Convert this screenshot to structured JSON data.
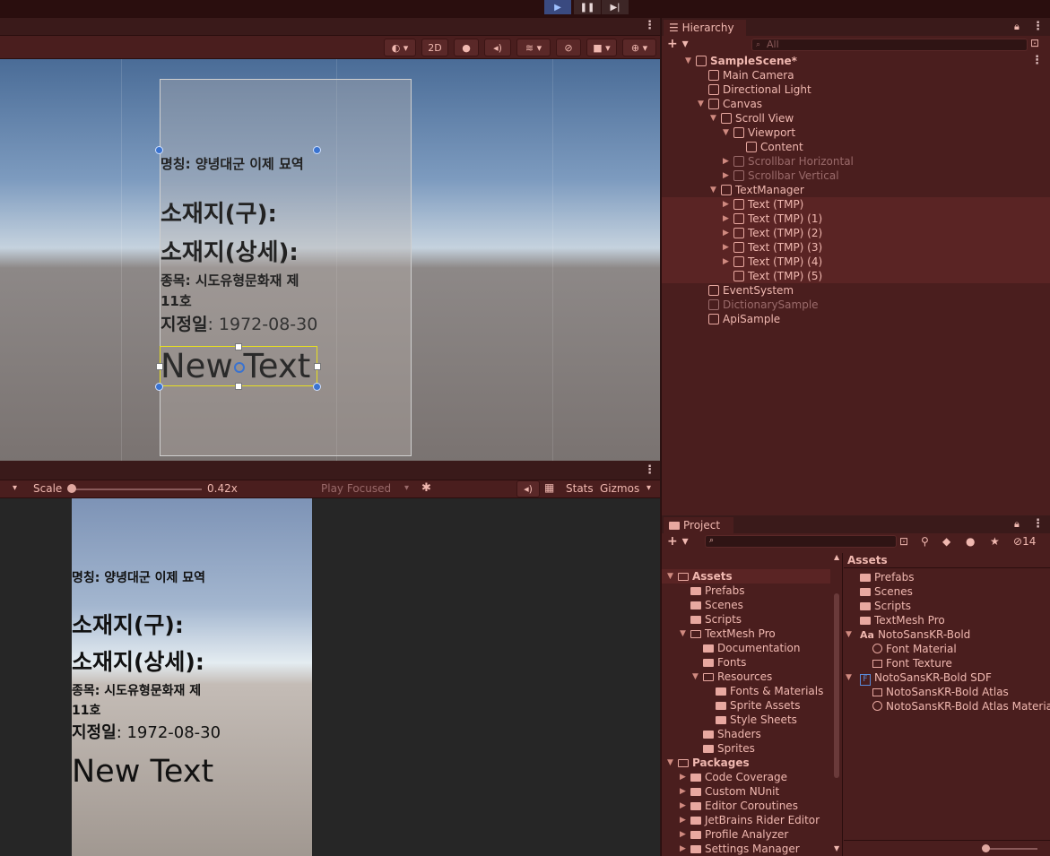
{
  "scene": {
    "toolbar": {
      "mode_2d": "2D"
    },
    "texts": {
      "name_label": "명칭",
      "name_value": ": 양녕대군 이제 묘역",
      "loc_old": "소재지(구):",
      "loc_detail": "소재지(상세):",
      "kind_label": "종목",
      "kind_value": ": 시도유형문화재 제",
      "kind_value2": "11호",
      "date_label": "지정일",
      "date_value": ": 1972-08-30",
      "new_text": "New Text"
    }
  },
  "game": {
    "toolbar": {
      "scale_label": "Scale",
      "scale_value": "0.42x",
      "play_focused": "Play Focused",
      "stats": "Stats",
      "gizmos": "Gizmos"
    }
  },
  "hierarchy": {
    "title": "Hierarchy",
    "search_placeholder": "All",
    "items": [
      {
        "label": "SampleScene*",
        "depth": 0,
        "expanded": true,
        "bold": true
      },
      {
        "label": "Main Camera",
        "depth": 1
      },
      {
        "label": "Directional Light",
        "depth": 1
      },
      {
        "label": "Canvas",
        "depth": 1,
        "expanded": true
      },
      {
        "label": "Scroll View",
        "depth": 2,
        "expanded": true
      },
      {
        "label": "Viewport",
        "depth": 3,
        "expanded": true
      },
      {
        "label": "Content",
        "depth": 4
      },
      {
        "label": "Scrollbar Horizontal",
        "depth": 3,
        "collapsed": true,
        "dim": true
      },
      {
        "label": "Scrollbar Vertical",
        "depth": 3,
        "collapsed": true,
        "dim": true
      },
      {
        "label": "TextManager",
        "depth": 2,
        "expanded": true
      },
      {
        "label": "Text (TMP)",
        "depth": 3,
        "collapsed": true,
        "selected": true
      },
      {
        "label": "Text (TMP) (1)",
        "depth": 3,
        "collapsed": true,
        "selected": true
      },
      {
        "label": "Text (TMP) (2)",
        "depth": 3,
        "collapsed": true,
        "selected": true
      },
      {
        "label": "Text (TMP) (3)",
        "depth": 3,
        "collapsed": true,
        "selected": true
      },
      {
        "label": "Text (TMP) (4)",
        "depth": 3,
        "collapsed": true,
        "selected": true
      },
      {
        "label": "Text (TMP) (5)",
        "depth": 3,
        "selected": true
      },
      {
        "label": "EventSystem",
        "depth": 1
      },
      {
        "label": "DictionarySample",
        "depth": 1,
        "dim": true
      },
      {
        "label": "ApiSample",
        "depth": 1
      }
    ]
  },
  "project": {
    "title": "Project",
    "hidden_count": "14",
    "tree": [
      {
        "label": "Assets",
        "depth": 0,
        "open": true,
        "bold": true,
        "selected": true
      },
      {
        "label": "Prefabs",
        "depth": 1
      },
      {
        "label": "Scenes",
        "depth": 1
      },
      {
        "label": "Scripts",
        "depth": 1
      },
      {
        "label": "TextMesh Pro",
        "depth": 1,
        "open": true
      },
      {
        "label": "Documentation",
        "depth": 2
      },
      {
        "label": "Fonts",
        "depth": 2
      },
      {
        "label": "Resources",
        "depth": 2,
        "open": true
      },
      {
        "label": "Fonts & Materials",
        "depth": 3
      },
      {
        "label": "Sprite Assets",
        "depth": 3
      },
      {
        "label": "Style Sheets",
        "depth": 3
      },
      {
        "label": "Shaders",
        "depth": 2
      },
      {
        "label": "Sprites",
        "depth": 2
      },
      {
        "label": "Packages",
        "depth": 0,
        "open": true,
        "bold": true
      },
      {
        "label": "Code Coverage",
        "depth": 1,
        "collapsed": true
      },
      {
        "label": "Custom NUnit",
        "depth": 1,
        "collapsed": true
      },
      {
        "label": "Editor Coroutines",
        "depth": 1,
        "collapsed": true
      },
      {
        "label": "JetBrains Rider Editor",
        "depth": 1,
        "collapsed": true
      },
      {
        "label": "Profile Analyzer",
        "depth": 1,
        "collapsed": true
      },
      {
        "label": "Settings Manager",
        "depth": 1,
        "collapsed": true
      }
    ],
    "grid_header": "Assets",
    "grid": [
      {
        "label": "Prefabs",
        "icon": "folder",
        "depth": 0
      },
      {
        "label": "Scenes",
        "icon": "folder",
        "depth": 0
      },
      {
        "label": "Scripts",
        "icon": "folder",
        "depth": 0
      },
      {
        "label": "TextMesh Pro",
        "icon": "folder",
        "depth": 0
      },
      {
        "label": "NotoSansKR-Bold",
        "icon": "font",
        "depth": 0,
        "expanded": true
      },
      {
        "label": "Font Material",
        "icon": "material",
        "depth": 1
      },
      {
        "label": "Font Texture",
        "icon": "texture",
        "depth": 1
      },
      {
        "label": "NotoSansKR-Bold SDF",
        "icon": "fontasset",
        "depth": 0,
        "expanded": true
      },
      {
        "label": "NotoSansKR-Bold Atlas",
        "icon": "texture",
        "depth": 1
      },
      {
        "label": "NotoSansKR-Bold Atlas Material",
        "icon": "material",
        "depth": 1
      }
    ]
  }
}
